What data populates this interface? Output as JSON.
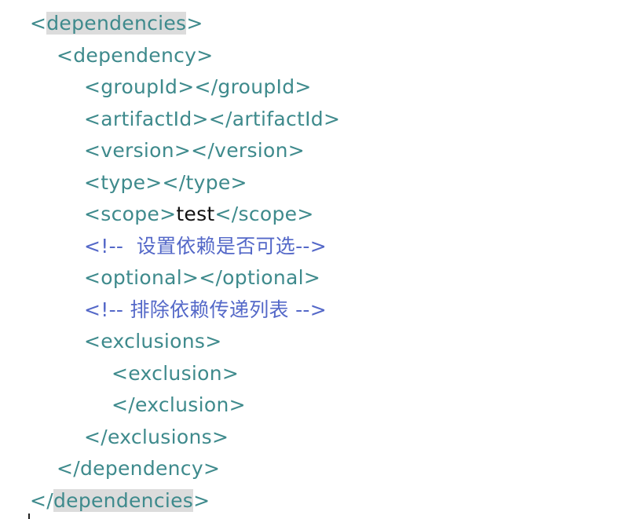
{
  "colors": {
    "tag": "#3e8a8c",
    "text": "#111111",
    "comment": "#5468c8",
    "highlight": "#dcdcdc"
  },
  "lines": [
    {
      "indent": 0,
      "segments": [
        {
          "t": "tag",
          "v": "<"
        },
        {
          "t": "tag hl",
          "v": "dependencies"
        },
        {
          "t": "tag",
          "v": ">"
        }
      ]
    },
    {
      "indent": 1,
      "segments": [
        {
          "t": "tag",
          "v": "<dependency>"
        }
      ]
    },
    {
      "indent": 2,
      "segments": [
        {
          "t": "tag",
          "v": "<groupId></groupId>"
        }
      ]
    },
    {
      "indent": 2,
      "segments": [
        {
          "t": "tag",
          "v": "<artifactId></artifactId>"
        }
      ]
    },
    {
      "indent": 2,
      "segments": [
        {
          "t": "tag",
          "v": "<version></version>"
        }
      ]
    },
    {
      "indent": 2,
      "segments": [
        {
          "t": "tag",
          "v": "<type></type>"
        }
      ]
    },
    {
      "indent": 2,
      "segments": [
        {
          "t": "tag",
          "v": "<scope>"
        },
        {
          "t": "text",
          "v": "test"
        },
        {
          "t": "tag",
          "v": "</scope>"
        }
      ]
    },
    {
      "indent": 2,
      "segments": [
        {
          "t": "comment",
          "v": "<!--  设置依赖是否可选-->"
        }
      ]
    },
    {
      "indent": 2,
      "segments": [
        {
          "t": "tag",
          "v": "<optional></optional>"
        }
      ]
    },
    {
      "indent": 2,
      "segments": [
        {
          "t": "comment",
          "v": "<!-- 排除依赖传递列表 -->"
        }
      ]
    },
    {
      "indent": 2,
      "segments": [
        {
          "t": "tag",
          "v": "<exclusions>"
        }
      ]
    },
    {
      "indent": 3,
      "segments": [
        {
          "t": "tag",
          "v": "<exclusion>"
        }
      ]
    },
    {
      "indent": 3,
      "segments": [
        {
          "t": "tag",
          "v": "</exclusion>"
        }
      ]
    },
    {
      "indent": 2,
      "segments": [
        {
          "t": "tag",
          "v": "</exclusions>"
        }
      ]
    },
    {
      "indent": 1,
      "segments": [
        {
          "t": "tag",
          "v": "</dependency>"
        }
      ]
    },
    {
      "indent": 0,
      "segments": [
        {
          "t": "tag",
          "v": "</"
        },
        {
          "t": "tag hl",
          "v": "dependencies"
        },
        {
          "t": "tag",
          "v": ">"
        }
      ]
    }
  ]
}
